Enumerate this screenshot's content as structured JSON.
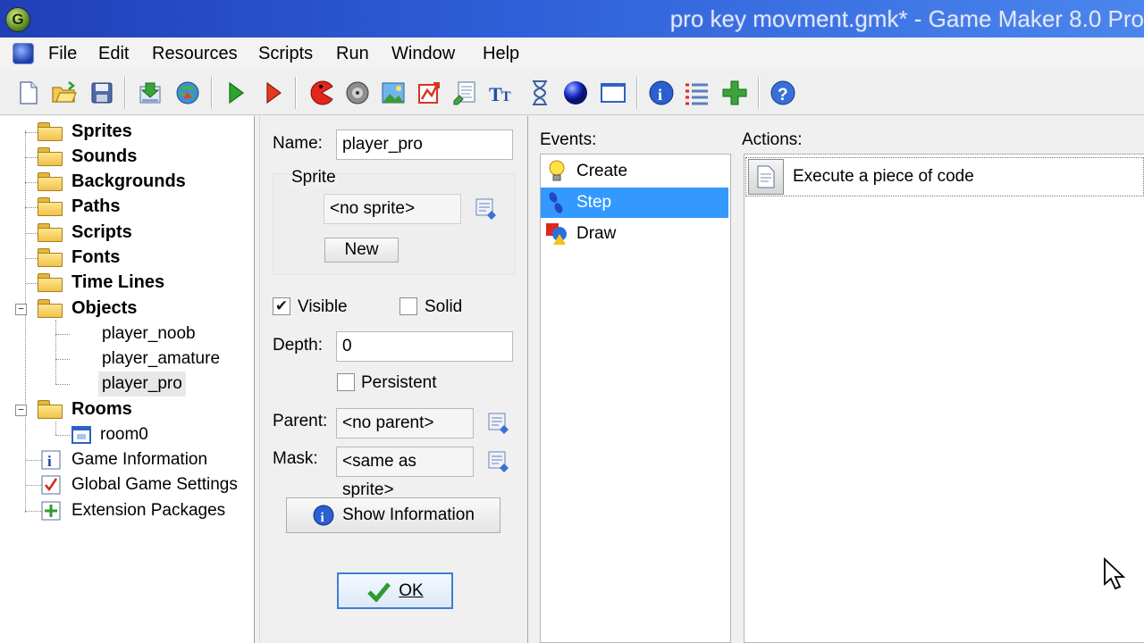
{
  "window": {
    "title": "pro key movment.gmk* - Game Maker 8.0 Pro",
    "app_icon_glyph": "G"
  },
  "menu": [
    "File",
    "Edit",
    "Resources",
    "Scripts",
    "Run",
    "Window",
    "Help"
  ],
  "toolbar": {
    "icons": [
      "new-file-icon",
      "open-folder-icon",
      "save-icon",
      "export-game-icon",
      "publish-icon",
      "run-icon",
      "debug-icon",
      "add-sprite-icon",
      "add-sound-icon",
      "add-background-icon",
      "add-path-icon",
      "add-script-icon",
      "add-font-icon",
      "add-timeline-icon",
      "add-object-icon",
      "add-room-icon",
      "game-information-icon",
      "global-settings-icon",
      "extension-packages-icon",
      "help-icon"
    ]
  },
  "tree": {
    "folders": [
      "Sprites",
      "Sounds",
      "Backgrounds",
      "Paths",
      "Scripts",
      "Fonts",
      "Time Lines",
      "Objects"
    ],
    "objects": [
      "player_noob",
      "player_amature",
      "player_pro"
    ],
    "selected_object": "player_pro",
    "rooms_folder": "Rooms",
    "rooms": [
      "room0"
    ],
    "extras": [
      "Game Information",
      "Global Game Settings",
      "Extension Packages"
    ]
  },
  "object_properties": {
    "name_label": "Name:",
    "name_value": "player_pro",
    "sprite_group_label": "Sprite",
    "sprite_value": "<no sprite>",
    "new_button": "New",
    "visible_label": "Visible",
    "visible_checked": true,
    "solid_label": "Solid",
    "solid_checked": false,
    "depth_label": "Depth:",
    "depth_value": "0",
    "persistent_label": "Persistent",
    "persistent_checked": false,
    "parent_label": "Parent:",
    "parent_value": "<no parent>",
    "mask_label": "Mask:",
    "mask_value": "<same as sprite>",
    "show_info_button": "Show Information",
    "ok_button": "OK"
  },
  "events": {
    "label": "Events:",
    "items": [
      "Create",
      "Step",
      "Draw"
    ],
    "selected": "Step"
  },
  "actions": {
    "label": "Actions:",
    "items": [
      "Execute a piece of code"
    ]
  },
  "colors": {
    "selection": "#3399ff",
    "titlebar": "#2f5fd8"
  }
}
